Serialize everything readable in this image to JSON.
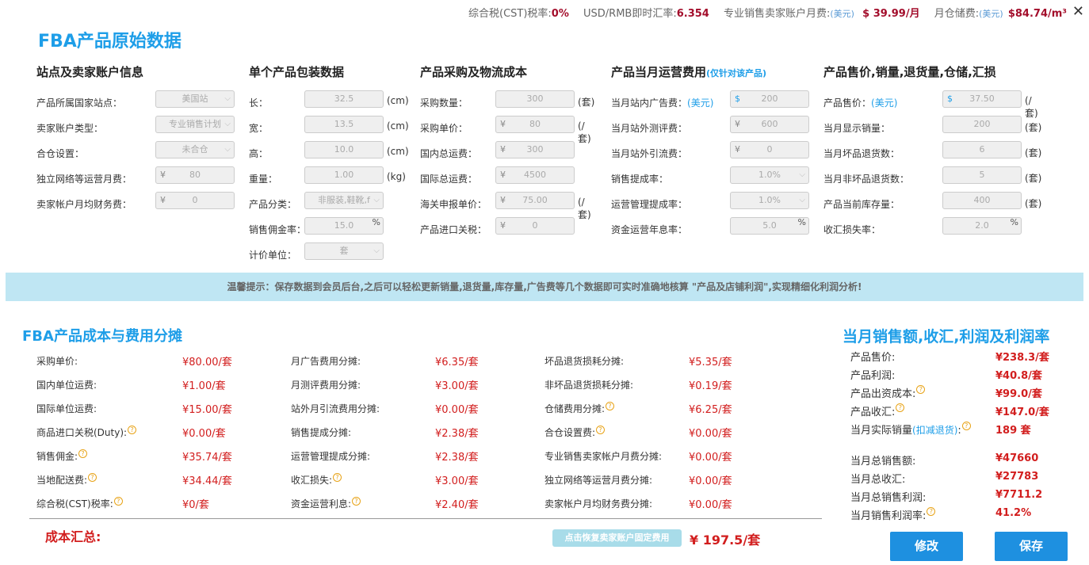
{
  "topbar": {
    "cst_label": "综合税(CST)税率:",
    "cst_value": "0%",
    "fx_label": "USD/RMB即时汇率:",
    "fx_value": "6.354",
    "fee_label": "专业销售卖家账户月费:",
    "fee_usd": "(美元)",
    "fee_value": "$ 39.99/月",
    "storage_label": "月仓储费:",
    "storage_usd": "(美元)",
    "storage_value": "$84.74/m³"
  },
  "main_title": "FBA产品原始数据",
  "col1": {
    "title": "站点及卖家账户信息",
    "rows": [
      {
        "label": "产品所属国家站点：",
        "value": "美国站"
      },
      {
        "label": "卖家账户类型：",
        "value": "专业销售计划"
      },
      {
        "label": "合仓设置：",
        "value": "未合仓"
      },
      {
        "label": "独立网络等运营月费：",
        "prefix": "¥",
        "value": "80"
      },
      {
        "label": "卖家帐户月均财务费：",
        "prefix": "¥",
        "value": "0"
      }
    ]
  },
  "col2": {
    "title": "单个产品包装数据",
    "rows": [
      {
        "label": "长：",
        "value": "32.5",
        "unit": "(cm)"
      },
      {
        "label": "宽：",
        "value": "13.5",
        "unit": "(cm)"
      },
      {
        "label": "高：",
        "value": "10.0",
        "unit": "(cm)"
      },
      {
        "label": "重量：",
        "value": "1.00",
        "unit": "(kg)"
      },
      {
        "label": "产品分类：",
        "value": "非服装,鞋靴,f"
      },
      {
        "label": "销售佣金率：",
        "value": "15.0",
        "pct": "%"
      },
      {
        "label": "计价单位：",
        "value": "套"
      }
    ]
  },
  "col3": {
    "title": "产品采购及物流成本",
    "rows": [
      {
        "label": "采购数量：",
        "value": "300",
        "unit": "(套)"
      },
      {
        "label": "采购单价：",
        "prefix": "¥",
        "value": "80",
        "unit": "(/套)"
      },
      {
        "label": "国内总运费：",
        "prefix": "¥",
        "value": "300"
      },
      {
        "label": "国际总运费：",
        "prefix": "¥",
        "value": "4500"
      },
      {
        "label": "海关申报单价：",
        "prefix": "¥",
        "value": "75.00",
        "unit": "(/套)"
      },
      {
        "label": "产品进口关税：",
        "prefix": "¥",
        "value": "0"
      }
    ]
  },
  "col4": {
    "title": "产品当月运营费用",
    "title_sub": "(仅针对该产品)",
    "rows": [
      {
        "label": "当月站内广告费：",
        "label_usd": "(美元)",
        "prefix": "$",
        "value": "200"
      },
      {
        "label": "当月站外测评费：",
        "prefix": "¥",
        "value": "600"
      },
      {
        "label": "当月站外引流费：",
        "prefix": "¥",
        "value": "0"
      },
      {
        "label": "销售提成率：",
        "value": "1.0%"
      },
      {
        "label": "运营管理提成率：",
        "value": "1.0%"
      },
      {
        "label": "资金运营年息率：",
        "value": "5.0",
        "pct": "%"
      }
    ]
  },
  "col5": {
    "title": "产品售价,销量,退货量,仓储,汇损",
    "rows": [
      {
        "label": "产品售价：",
        "label_usd": "(美元)",
        "prefix": "$",
        "value": "37.50",
        "unit": "(/套)"
      },
      {
        "label": "当月显示销量：",
        "value": "200",
        "unit": "(套)"
      },
      {
        "label": "当月坏品退货数：",
        "value": "6",
        "unit": "(套)"
      },
      {
        "label": "当月非坏品退货数：",
        "value": "5",
        "unit": "(套)"
      },
      {
        "label": "产品当前库存量：",
        "value": "400",
        "unit": "(套)"
      },
      {
        "label": "收汇损失率：",
        "value": "2.0",
        "pct": "%"
      }
    ]
  },
  "notice": "温馨提示：保存数据到会员后台,之后可以轻松更新销量,退货量,库存量,广告费等几个数据即可实时准确地核算 \"产品及店铺利润\",实现精细化利润分析!",
  "cost_title": "FBA产品成本与费用分摊",
  "cost_cols": [
    [
      {
        "k": "采购单价:",
        "v": "¥80.00/套"
      },
      {
        "k": "国内单位运费:",
        "v": "¥1.00/套"
      },
      {
        "k": "国际单位运费:",
        "v": "¥15.00/套"
      },
      {
        "k": "商品进口关税(Duty):",
        "v": "¥0.00/套",
        "q": true
      },
      {
        "k": "销售佣金:",
        "v": "¥35.74/套",
        "q": true
      },
      {
        "k": "当地配送费:",
        "v": "¥34.44/套",
        "q": true
      },
      {
        "k": "综合税(CST)税率:",
        "v": "¥0/套",
        "q": true
      }
    ],
    [
      {
        "k": "月广告费用分摊:",
        "v": "¥6.35/套"
      },
      {
        "k": "月测评费用分摊:",
        "v": "¥3.00/套"
      },
      {
        "k": "站外月引流费用分摊:",
        "v": "¥0.00/套"
      },
      {
        "k": "销售提成分摊:",
        "v": "¥2.38/套"
      },
      {
        "k": "运营管理提成分摊:",
        "v": "¥2.38/套"
      },
      {
        "k": "收汇损失:",
        "v": "¥3.00/套",
        "q": true
      },
      {
        "k": "资金运营利息:",
        "v": "¥2.40/套",
        "q": true
      }
    ],
    [
      {
        "k": "坏品退货损耗分摊:",
        "v": "¥5.35/套"
      },
      {
        "k": "非坏品退货损耗分摊:",
        "v": "¥0.19/套"
      },
      {
        "k": "仓储费用分摊:",
        "v": "¥6.25/套",
        "q": true
      },
      {
        "k": "合仓设置费:",
        "v": "¥0.00/套",
        "q": true
      },
      {
        "k": "专业销售卖家帐户月费分摊:",
        "v": "¥0.00/套"
      },
      {
        "k": "独立网络等运营月费分摊:",
        "v": "¥0.00/套"
      },
      {
        "k": "卖家帐户月均财务费分摊:",
        "v": "¥0.00/套"
      }
    ]
  ],
  "summary": {
    "label": "成本汇总:",
    "restore": "点击恢复卖家账户固定费用",
    "value": "¥ 197.5/套"
  },
  "right": {
    "title": "当月销售额,收汇,利润及利润率",
    "group1": [
      {
        "k": "产品售价:",
        "v": "¥238.3/套"
      },
      {
        "k": "产品利润:",
        "v": "¥40.8/套"
      },
      {
        "k": "产品出资成本:",
        "v": "¥99.0/套",
        "q": true
      },
      {
        "k": "产品收汇:",
        "v": "¥147.0/套",
        "q": true
      },
      {
        "k": "当月实际销量",
        "k2": "(扣减退货)",
        "k3": ":",
        "v": "189 套",
        "q": true
      }
    ],
    "group2": [
      {
        "k": "当月总销售额:",
        "v": "¥47660"
      },
      {
        "k": "当月总收汇:",
        "v": "¥27783"
      },
      {
        "k": "当月总销售利润:",
        "v": "¥7711.2"
      },
      {
        "k": "当月销售利润率:",
        "v": "41.2%",
        "q": true
      }
    ]
  },
  "buttons": {
    "edit": "修改",
    "save": "保存"
  }
}
